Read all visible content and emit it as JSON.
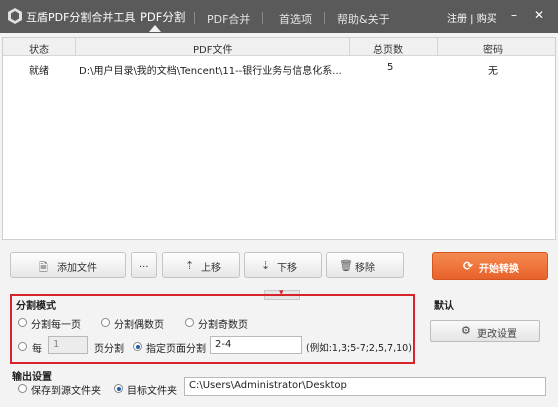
{
  "app": {
    "title": "互盾PDF分割合并工具"
  },
  "tabs": [
    {
      "label": "PDF分割",
      "active": true
    },
    {
      "label": "PDF合并",
      "active": false
    },
    {
      "label": "首选项",
      "active": false
    },
    {
      "label": "帮助&关于",
      "active": false
    }
  ],
  "account": {
    "label": "注册 | 购买"
  },
  "window_controls": {
    "minimize": "–",
    "close": "✕"
  },
  "table": {
    "headers": [
      "状态",
      "PDF文件",
      "总页数",
      "密码"
    ],
    "rows": [
      {
        "status": "就绪",
        "file": "D:\\用户目录\\我的文档\\Tencent\\11--银行业务与信息化系...",
        "pages": "5",
        "password": "无"
      }
    ]
  },
  "toolbar": {
    "add_file": "添加文件",
    "more": "...",
    "move_up": "上移",
    "move_down": "下移",
    "remove": "移除",
    "start": "开始转换"
  },
  "split_mode": {
    "title": "分割模式",
    "every_page": "分割每一页",
    "even_pages": "分割偶数页",
    "odd_pages": "分割奇数页",
    "every_label": "每",
    "every_value": "1",
    "pages_split": "页分割",
    "specified": "指定页面分割",
    "specified_value": "2-4",
    "hint": "(例如:1,3;5-7;2,5,7,10)",
    "selected": "specified"
  },
  "default_panel": {
    "title": "默认",
    "settings_button": "更改设置"
  },
  "output": {
    "title": "输出设置",
    "save_to_source": "保存到源文件夹",
    "target_folder": "目标文件夹",
    "path": "C:\\Users\\Administrator\\Desktop",
    "selected": "target"
  },
  "colors": {
    "titlebar": "#5a5a5a",
    "accent_orange": "#e8622a",
    "highlight_red": "#d9232b"
  }
}
